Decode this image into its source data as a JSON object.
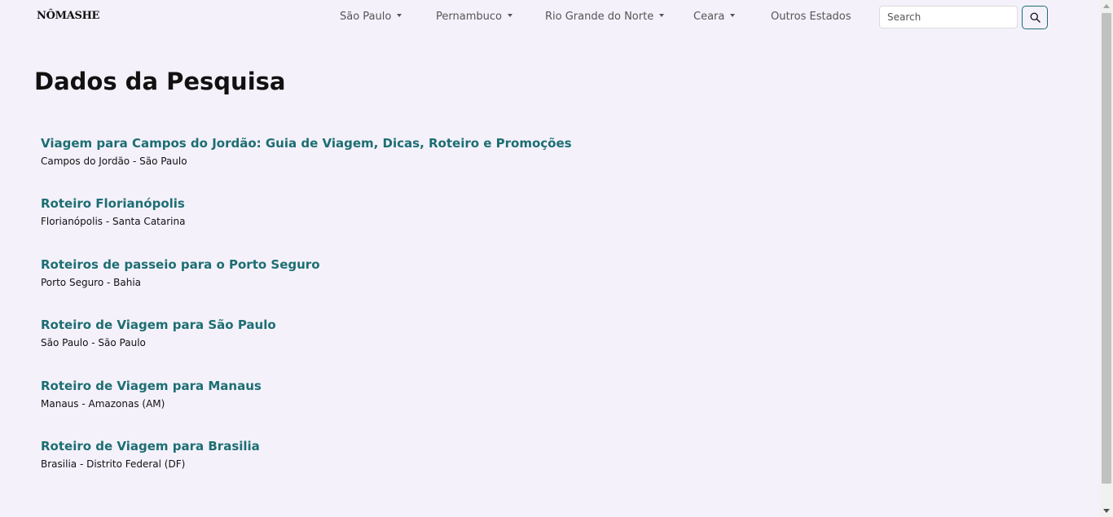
{
  "brand": "NÔMASHE",
  "nav": {
    "items": [
      {
        "label": "São Paulo",
        "dropdown": true
      },
      {
        "label": "Pernambuco",
        "dropdown": true
      },
      {
        "label": "Rio Grande do Norte",
        "dropdown": true
      },
      {
        "label": "Ceara",
        "dropdown": true
      },
      {
        "label": "Outros Estados",
        "dropdown": false
      }
    ],
    "search_placeholder": "Search",
    "search_icon": "search-icon"
  },
  "page_title": "Dados da Pesquisa",
  "results": [
    {
      "title": "Viagem para Campos do Jordão: Guia de Viagem, Dicas, Roteiro e Promoções",
      "location": "Campos do Jordão - São Paulo"
    },
    {
      "title": "Roteiro Florianópolis",
      "location": "Florianópolis - Santa Catarina"
    },
    {
      "title": "Roteiros de passeio para o Porto Seguro",
      "location": "Porto Seguro - Bahia"
    },
    {
      "title": "Roteiro de Viagem para São Paulo",
      "location": "São Paulo - São Paulo"
    },
    {
      "title": "Roteiro de Viagem para Manaus",
      "location": "Manaus - Amazonas (AM)"
    },
    {
      "title": "Roteiro de Viagem para Brasilia",
      "location": "Brasilia - Distrito Federal (DF)"
    }
  ],
  "colors": {
    "background": "#f4f1fb",
    "link": "#1d6e72",
    "accent_border": "#1f6f73"
  }
}
